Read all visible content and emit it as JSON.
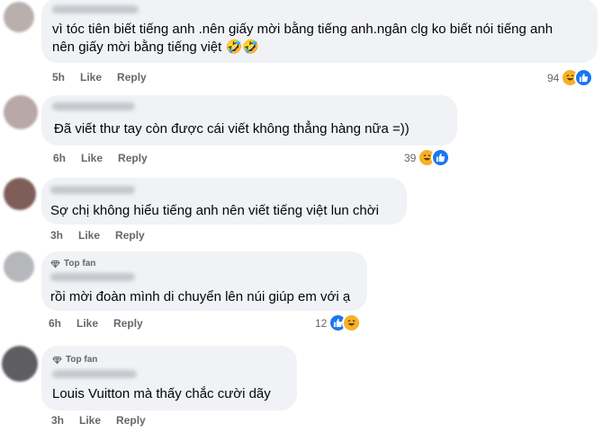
{
  "comments": [
    {
      "text_lines": [
        "vì tóc tiên biết tiếng anh .nên giấy mời bằng tiếng anh.ngân clg ko biết nói tiếng anh",
        "nên giấy mời bằng tiếng việt 🤣🤣"
      ],
      "time": "5h",
      "like": "Like",
      "reply": "Reply",
      "count": "94",
      "reactions": [
        "haha-icon",
        "like-icon"
      ],
      "avatar_color": "#b9b0ae"
    },
    {
      "text_lines": [
        "Đã viết thư tay còn được cái viết không thẳng hàng nữa =))"
      ],
      "time": "6h",
      "like": "Like",
      "reply": "Reply",
      "count": "39",
      "reactions": [
        "haha-icon",
        "like-icon"
      ],
      "avatar_color": "#b8a8a6"
    },
    {
      "text_lines": [
        "Sợ chị không hiểu tiếng anh nên viết tiếng việt lun chời"
      ],
      "time": "3h",
      "like": "Like",
      "reply": "Reply",
      "avatar_color": "#7f5e58"
    },
    {
      "badge": "Top fan",
      "text_lines": [
        "rồi mời đoàn mình di chuyển lên núi giúp em với ạ"
      ],
      "time": "6h",
      "like": "Like",
      "reply": "Reply",
      "count": "12",
      "reactions": [
        "like-icon",
        "haha-icon"
      ],
      "avatar_color": "#b5b7bb"
    },
    {
      "badge": "Top fan",
      "text_lines": [
        "Louis Vuitton mà thấy chắc cười dãy"
      ],
      "time": "3h",
      "like": "Like",
      "reply": "Reply",
      "avatar_color": "#5e5e62"
    }
  ]
}
